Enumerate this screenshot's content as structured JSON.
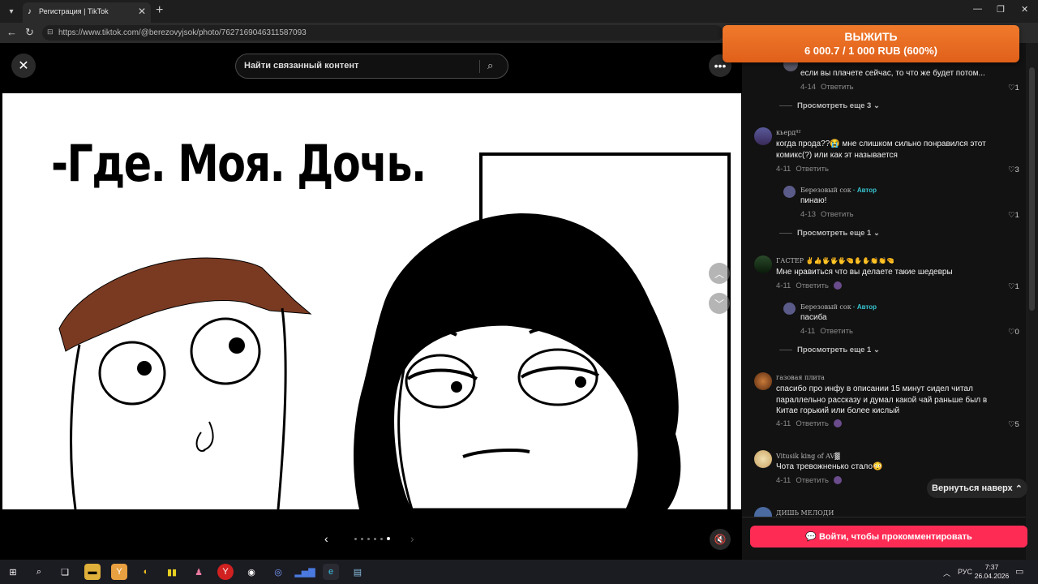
{
  "browser": {
    "tab_title": "Регистрация | TikTok",
    "url": "https://www.tiktok.com/@berezovyjsok/photo/7627169046311587093"
  },
  "promo": {
    "line1": "ВЫЖИТЬ",
    "line2": "6 000.7 / 1 000 RUB (600%)"
  },
  "viewer": {
    "search_placeholder": "Найти связанный контент",
    "caption": "-Где. Моя. Дочь.",
    "slides_total": 6,
    "slide_active": 6
  },
  "comments": [
    {
      "text": "если вы плачете сейчас, то что же будет потом...",
      "date": "4-14",
      "reply": "Ответить",
      "likes": "1",
      "view_more": "Просмотреть еще 3"
    },
    {
      "user": "кьерд⁴²",
      "text": "когда прода??😭 мне слишком сильно понравился этот комикс(?) или как эт называется",
      "date": "4-11",
      "reply": "Ответить",
      "likes": "3"
    },
    {
      "user": "Березовый сок",
      "badge": " · Автор",
      "text": "пинаю!",
      "date": "4-13",
      "reply": "Ответить",
      "likes": "1",
      "view_more": "Просмотреть еще 1"
    },
    {
      "user": "ГАСТЕР ✌👍🖐🖐🖐🤏✋✋👏👏🤏",
      "text": "Мне нравиться что вы делаете такие шедевры",
      "date": "4-11",
      "reply": "Ответить",
      "likes": "1"
    },
    {
      "user": "Березовый сок",
      "badge": " · Автор",
      "text": "пасиба",
      "date": "4-11",
      "reply": "Ответить",
      "likes": "0",
      "view_more": "Просмотреть еще 1"
    },
    {
      "user": "газовая плита",
      "text": "спасибо про инфу в описании 15 минут сидел читал параллельно рассказу и думал какой чай раньше был в Китае горький или более кислый",
      "date": "4-11",
      "reply": "Ответить",
      "likes": "5"
    },
    {
      "user": "Vitusik king of AV▓",
      "text": "Чота тревожненько стало😳",
      "date": "4-11",
      "reply": "Ответить"
    },
    {
      "user": "ДИШЬ МЕЛОДИ"
    }
  ],
  "back_to_top": "Вернуться наверх",
  "login_button": "Войти, чтобы прокомментировать",
  "taskbar": {
    "lang": "РУС",
    "time": "7:37",
    "date": "26.04.2026"
  },
  "colors": {
    "accent": "#fe2c55",
    "author_badge": "#38c4d0",
    "promo": "#e96b22"
  }
}
